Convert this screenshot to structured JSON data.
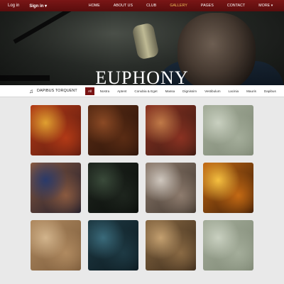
{
  "topbar": {
    "login": "Log in",
    "signin": "Sign in",
    "signin_caret": "▾",
    "nav": [
      {
        "label": "HOME",
        "active": false
      },
      {
        "label": "ABOUT US",
        "active": false
      },
      {
        "label": "CLUB",
        "active": false
      },
      {
        "label": "GALLERY",
        "active": true
      },
      {
        "label": "PAGES",
        "active": false
      },
      {
        "label": "CONTACT",
        "active": false
      },
      {
        "label": "MORE ▾",
        "active": false
      }
    ]
  },
  "hero": {
    "title": "EUPHONY"
  },
  "filterbar": {
    "brand_icon": "♫",
    "brand": "DAPIBUS TORQUENT",
    "filters": [
      {
        "label": "All",
        "active": true
      },
      {
        "label": "Nostra",
        "active": false
      },
      {
        "label": "Aptent",
        "active": false
      },
      {
        "label": "Conubia & Eget",
        "active": false
      },
      {
        "label": "Massa",
        "active": false
      },
      {
        "label": "Dignissim",
        "active": false
      },
      {
        "label": "Vestibulum",
        "active": false
      },
      {
        "label": "Lacinia",
        "active": false
      },
      {
        "label": "Mauris",
        "active": false
      },
      {
        "label": "Dapibus",
        "active": false
      }
    ]
  },
  "gallery": {
    "tiles": [
      {
        "icon": "carnival-image",
        "colors": [
          "#e0a030",
          "#b23a16",
          "#5a1a10"
        ]
      },
      {
        "icon": "guitar-wood-image",
        "colors": [
          "#8b4a25",
          "#5a2c14",
          "#2c140a"
        ]
      },
      {
        "icon": "cassette-image",
        "colors": [
          "#c07a48",
          "#8a3222",
          "#3a1a12"
        ]
      },
      {
        "icon": "vintage-paper-image",
        "colors": [
          "#c9d0c0",
          "#a4ad9a",
          "#7e8774"
        ]
      },
      {
        "icon": "dancer-image",
        "colors": [
          "#2a3a6a",
          "#8a5a40",
          "#1a1a2a"
        ]
      },
      {
        "icon": "drummer-image",
        "colors": [
          "#3a4a3a",
          "#1e251e",
          "#0a0d0a"
        ]
      },
      {
        "icon": "guitar-player-image",
        "colors": [
          "#cfc7be",
          "#8e7c6e",
          "#3e342c"
        ]
      },
      {
        "icon": "concert-crowd-image",
        "colors": [
          "#f5c040",
          "#c46a14",
          "#3a1a06"
        ]
      },
      {
        "icon": "sepia-sketch-image",
        "colors": [
          "#d2b48c",
          "#b08a60",
          "#7a5a3a"
        ]
      },
      {
        "icon": "radio-image",
        "colors": [
          "#3a6a7a",
          "#1e3a44",
          "#0d1a20"
        ]
      },
      {
        "icon": "violinist-image",
        "colors": [
          "#c4a070",
          "#8a6a44",
          "#3a2a1a"
        ]
      },
      {
        "icon": "vintage-paper-image-2",
        "colors": [
          "#c9d0c0",
          "#a4ad9a",
          "#7e8774"
        ]
      }
    ]
  }
}
